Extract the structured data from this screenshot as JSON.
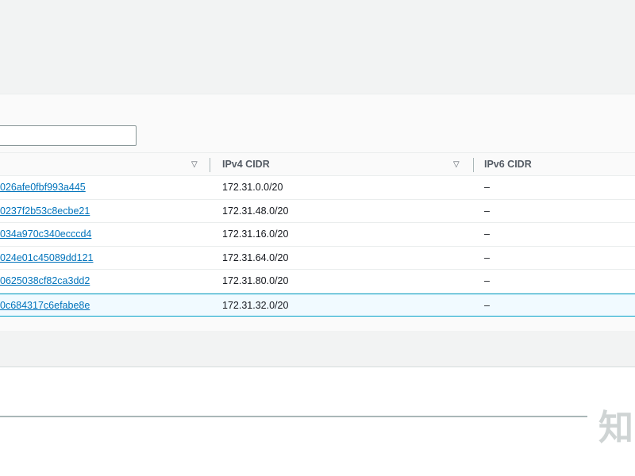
{
  "filter": {
    "value": "",
    "placeholder": ""
  },
  "columns": {
    "ipv4_cidr": "IPv4 CIDR",
    "ipv6_cidr": "IPv6 CIDR"
  },
  "rows": [
    {
      "subnet_id": "026afe0fbf993a445",
      "ipv4_cidr": "172.31.0.0/20",
      "ipv6_cidr": "–",
      "selected": false
    },
    {
      "subnet_id": "0237f2b53c8ecbe21",
      "ipv4_cidr": "172.31.48.0/20",
      "ipv6_cidr": "–",
      "selected": false
    },
    {
      "subnet_id": "034a970c340ecccd4",
      "ipv4_cidr": "172.31.16.0/20",
      "ipv6_cidr": "–",
      "selected": false
    },
    {
      "subnet_id": "024e01c45089dd121",
      "ipv4_cidr": "172.31.64.0/20",
      "ipv6_cidr": "–",
      "selected": false
    },
    {
      "subnet_id": "0625038cf82ca3dd2",
      "ipv4_cidr": "172.31.80.0/20",
      "ipv6_cidr": "–",
      "selected": false
    },
    {
      "subnet_id": "0c684317c6efabe8e",
      "ipv4_cidr": "172.31.32.0/20",
      "ipv6_cidr": "–",
      "selected": true
    }
  ],
  "watermark": "知",
  "colors": {
    "link": "#0073bb",
    "selected_border": "#00a1c9",
    "selected_bg": "#f1faff"
  },
  "icons": {
    "sort": "sort-down-icon"
  }
}
